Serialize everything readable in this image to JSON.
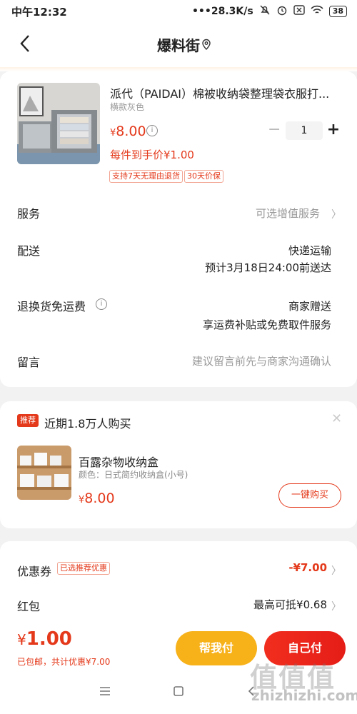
{
  "status_bar": {
    "time": "中午12:32",
    "speed": "28.3K/s",
    "battery": "38"
  },
  "nav": {
    "title": "爆料街"
  },
  "product": {
    "title": "派代（PAIDAI）棉被收纳袋整理袋衣服打...",
    "spec": "横款灰色",
    "price_symbol": "¥",
    "price": "8.00",
    "unit_price": "每件到手价¥1.00",
    "quantity": "1",
    "tags": [
      "支持7天无理由退货",
      "30天价保"
    ]
  },
  "rows": {
    "service_label": "服务",
    "service_value": "可选增值服务",
    "delivery_label": "配送",
    "delivery_method": "快递运输",
    "delivery_eta": "预计3月18日24:00前送达",
    "return_label": "退换货免运费",
    "return_value1": "商家赠送",
    "return_value2": "享运费补贴或免费取件服务",
    "note_label": "留言",
    "note_placeholder": "建议留言前先与商家沟通确认"
  },
  "recommend": {
    "badge": "推荐",
    "title": "近期1.8万人购买",
    "name": "百露杂物收纳盒",
    "spec": "颜色：日式简约收纳盒(小号)",
    "price_symbol": "¥",
    "price": "8.00",
    "buy_label": "一键购买"
  },
  "discounts": {
    "coupon_label": "优惠券",
    "coupon_tag": "已选推荐优惠",
    "coupon_value": "-¥7.00",
    "redpacket_label": "红包",
    "redpacket_value": "最高可抵¥0.68"
  },
  "footer": {
    "total_symbol": "¥",
    "total": "1.00",
    "note": "已包邮，共计优惠¥7.00",
    "help_pay_label": "帮我付",
    "self_pay_label": "自己付"
  },
  "watermark": {
    "text": "值值值",
    "url": "zhizhizhi.com"
  },
  "colors": {
    "accent": "#e4391b",
    "help_button": "#f7b119",
    "self_button": "#e51d18"
  }
}
